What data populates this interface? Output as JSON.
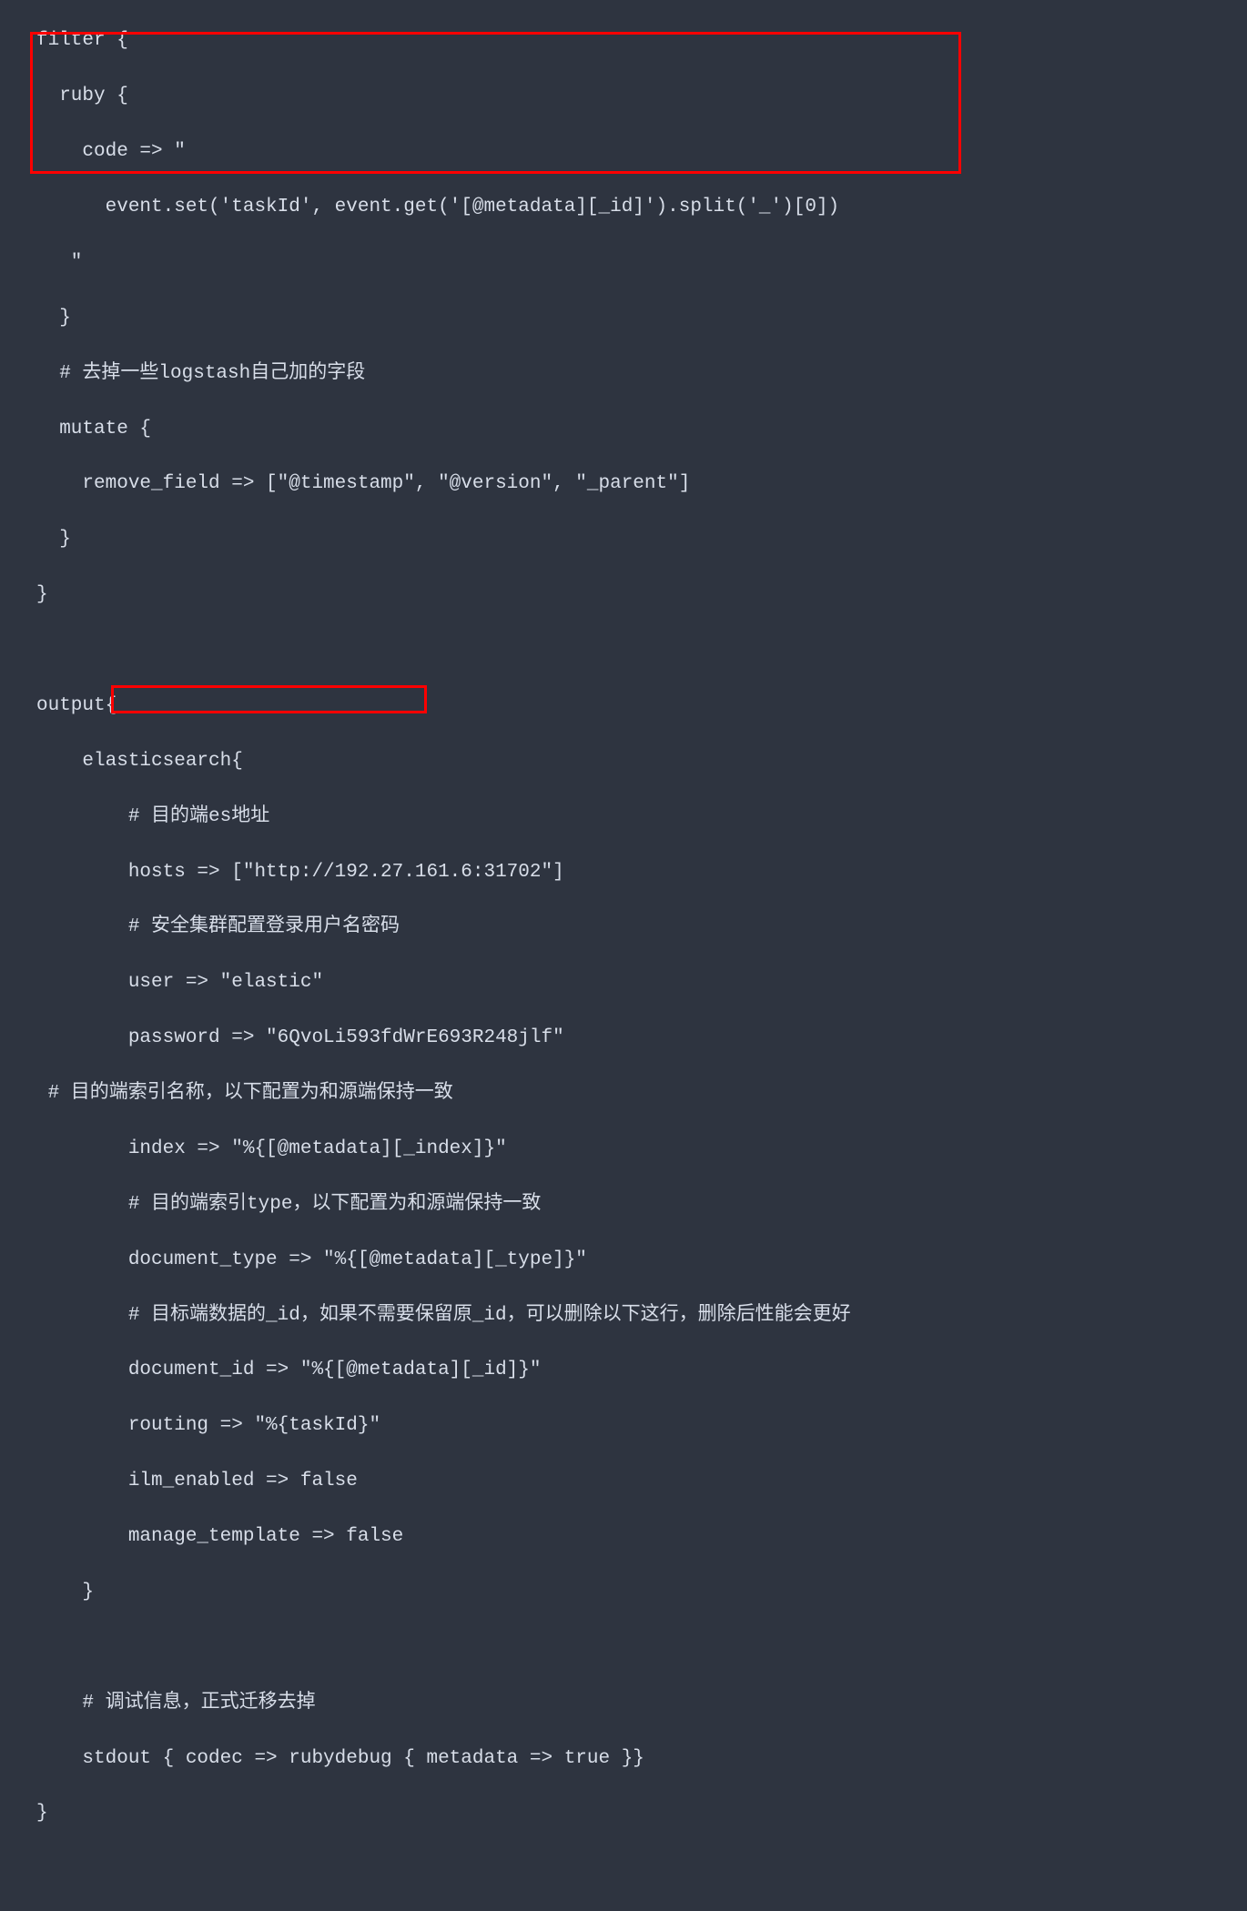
{
  "code": {
    "lines": [
      "filter {",
      "  ruby {",
      "    code => \"",
      "      event.set('taskId', event.get('[@metadata][_id]').split('_')[0])",
      "   \"",
      "  }",
      "  # 去掉一些logstash自己加的字段",
      "  mutate {",
      "    remove_field => [\"@timestamp\", \"@version\", \"_parent\"]",
      "  }",
      "}",
      "",
      "output{",
      "    elasticsearch{",
      "        # 目的端es地址",
      "        hosts => [\"http://192.27.161.6:31702\"]",
      "        # 安全集群配置登录用户名密码",
      "        user => \"elastic\"",
      "        password => \"6QvoLi593fdWrE693R248jlf\"",
      " # 目的端索引名称，以下配置为和源端保持一致",
      "        index => \"%{[@metadata][_index]}\"",
      "        # 目的端索引type，以下配置为和源端保持一致",
      "        document_type => \"%{[@metadata][_type]}\"",
      "        # 目标端数据的_id，如果不需要保留原_id，可以删除以下这行，删除后性能会更好",
      "        document_id => \"%{[@metadata][_id]}\"",
      "        routing => \"%{taskId}\"",
      "        ilm_enabled => false",
      "        manage_template => false",
      "    }",
      "",
      "    # 调试信息，正式迁移去掉",
      "    stdout { codec => rubydebug { metadata => true }}",
      "}"
    ]
  }
}
